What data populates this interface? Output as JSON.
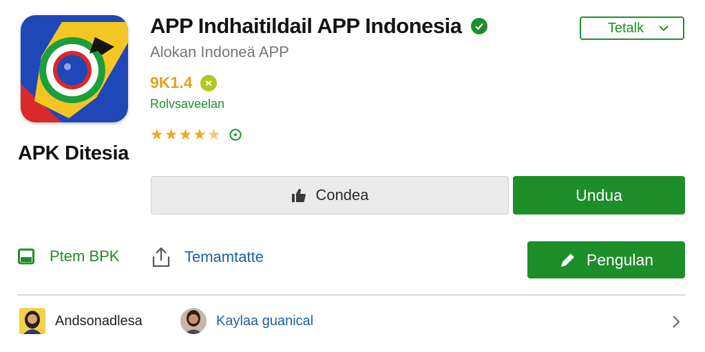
{
  "app": {
    "title": "APP Indhaitildail APP Indonesia",
    "developer": "Alokan Indoneä APP",
    "size": "9K1.4",
    "category": "Rolvsaveelan",
    "rating_stars": 4.5,
    "brand_label": "APK Ditesia",
    "verified_icon": "verified-check-icon"
  },
  "dropdown": {
    "label": "Tetalk"
  },
  "buttons": {
    "secondary_label": "Condea",
    "primary_label": "Undua",
    "review_label": "Pengulan"
  },
  "actions": {
    "save_label": "Ptem BPK",
    "share_label": "Temamtatte"
  },
  "users": [
    {
      "name": "Andsonadlesa"
    },
    {
      "name": "Kaylaa guanical"
    }
  ],
  "colors": {
    "accent_green": "#1e8e2a",
    "size_orange": "#e8a21a",
    "star_gold": "#f0a91c",
    "link_blue": "#1b5fa8"
  }
}
